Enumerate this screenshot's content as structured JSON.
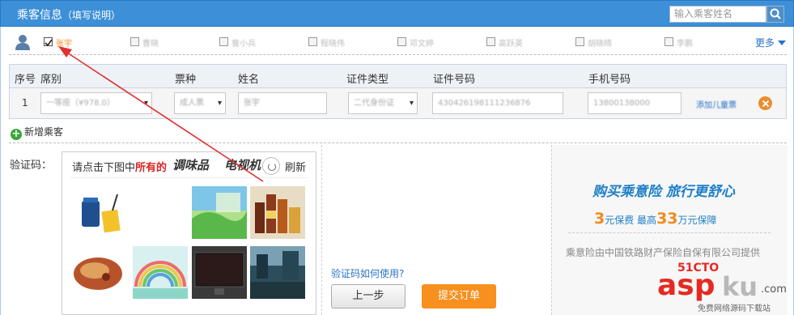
{
  "header": {
    "title": "乘客信息",
    "subtitle": "（填写说明）",
    "search_placeholder": "输入乘客姓名"
  },
  "contacts": {
    "names": [
      "张宇",
      "曹晓",
      "曾小兵",
      "程晓伟",
      "邓文婷",
      "高跃英",
      "胡晓晴",
      "李鹏"
    ],
    "more_label": "更多"
  },
  "table": {
    "headers": [
      "序号",
      "席别",
      "票种",
      "姓名",
      "证件类型",
      "证件号码",
      "手机号码"
    ],
    "row": {
      "index": "1",
      "seat": "一等座（¥978.0）",
      "ticket_type": "成人票",
      "name": "张宇",
      "id_type": "二代身份证",
      "id_number": "430426198111236876",
      "phone": "13800138000",
      "action_label": "添加儿童票"
    }
  },
  "add_passenger_label": "新增乘客",
  "captcha": {
    "label": "验证码：",
    "hint_prefix": "请点击下图中",
    "hint_emphasis": "所有的",
    "words": [
      "调味品",
      "电视机"
    ],
    "refresh_label": "刷新",
    "images": [
      "battery-and-phone",
      "green-landscape-card",
      "spice-bottles",
      "food-plate",
      "rainbow-illustration",
      "television-screen",
      "city-street"
    ],
    "help_link": "验证码如何使用?"
  },
  "buttons": {
    "prev": "上一步",
    "submit": "提交订单"
  },
  "insurance": {
    "title": "购买乘意险  旅行更舒心",
    "line_amount1": "3",
    "line_text1": "元保费  最高",
    "line_amount2": "33",
    "line_text2": "万元保障",
    "footer": "乘意险由中国铁路财产保险自保有限公司提供"
  },
  "watermark": {
    "brand_red": "asp",
    "brand_gray": "ku",
    "site": "51CTO",
    "com": ".com",
    "tagline": "免费网络源码下载站"
  },
  "colors": {
    "header_bg": "#3d8fd8",
    "accent_blue": "#1e7fc6",
    "orange": "#f7901e",
    "annotation_red": "#e03030"
  }
}
